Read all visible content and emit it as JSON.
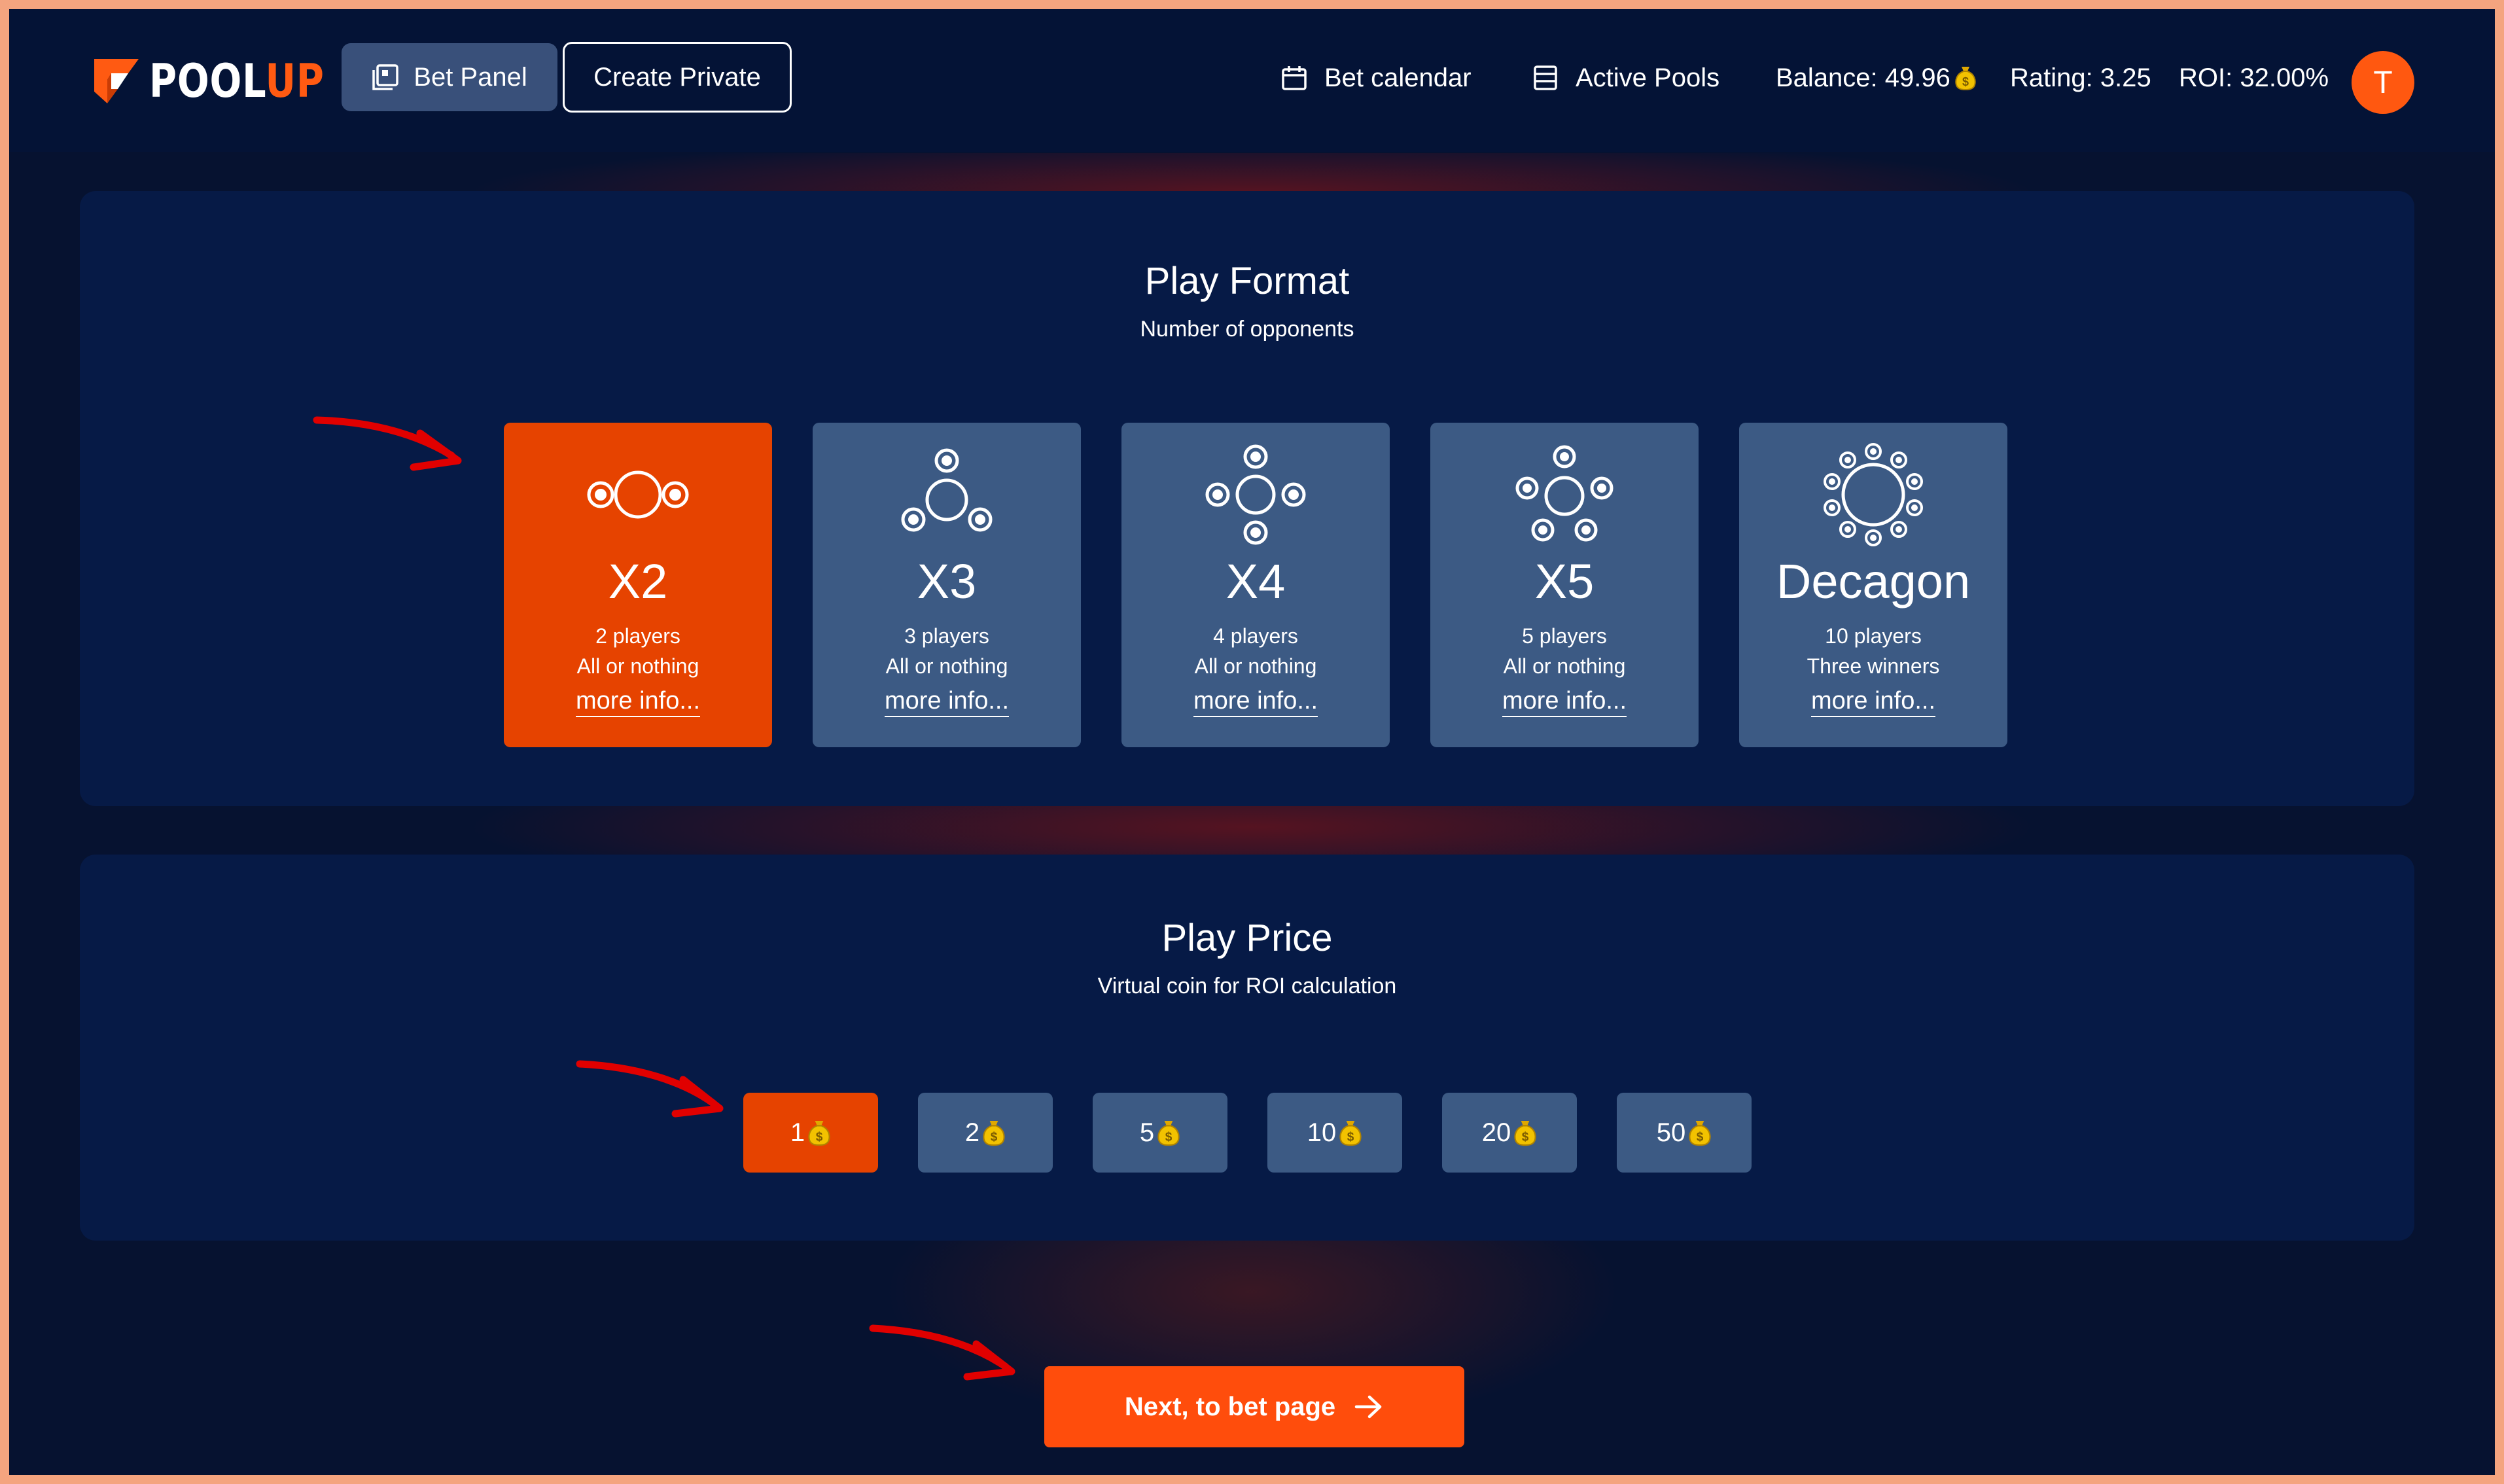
{
  "header": {
    "logo_text_white": "POOL",
    "logo_text_orange": "UP",
    "bet_panel_label": "Bet Panel",
    "create_private_label": "Create Private",
    "bet_calendar_label": "Bet calendar",
    "active_pools_label": "Active Pools",
    "balance_label": "Balance: 49.96",
    "rating_label": "Rating: 3.25",
    "roi_label": "ROI: 32.00%",
    "avatar_initial": "T"
  },
  "play_format": {
    "title": "Play Format",
    "subtitle": "Number of opponents",
    "cards": [
      {
        "name": "X2",
        "line1": "2 players",
        "line2": "All or nothing",
        "more": "more info...",
        "selected": true,
        "icon": "two-seats-icon"
      },
      {
        "name": "X3",
        "line1": "3 players",
        "line2": "All or nothing",
        "more": "more info...",
        "selected": false,
        "icon": "three-seats-icon"
      },
      {
        "name": "X4",
        "line1": "4 players",
        "line2": "All or nothing",
        "more": "more info...",
        "selected": false,
        "icon": "four-seats-icon"
      },
      {
        "name": "X5",
        "line1": "5 players",
        "line2": "All or nothing",
        "more": "more info...",
        "selected": false,
        "icon": "five-seats-icon"
      },
      {
        "name": "Decagon",
        "line1": "10 players",
        "line2": "Three winners",
        "more": "more info...",
        "selected": false,
        "icon": "ten-seats-icon"
      }
    ]
  },
  "play_price": {
    "title": "Play Price",
    "subtitle": "Virtual coin for ROI calculation",
    "options": [
      {
        "value": "1",
        "selected": true
      },
      {
        "value": "2",
        "selected": false
      },
      {
        "value": "5",
        "selected": false
      },
      {
        "value": "10",
        "selected": false
      },
      {
        "value": "20",
        "selected": false
      },
      {
        "value": "50",
        "selected": false
      }
    ]
  },
  "next_button_label": "Next, to bet page",
  "colors": {
    "accent": "#ff4d0c",
    "selected": "#e64300",
    "card": "#3c5a84",
    "panel": "#061a46",
    "background": "#061230",
    "annotation_arrow": "#e00000"
  }
}
